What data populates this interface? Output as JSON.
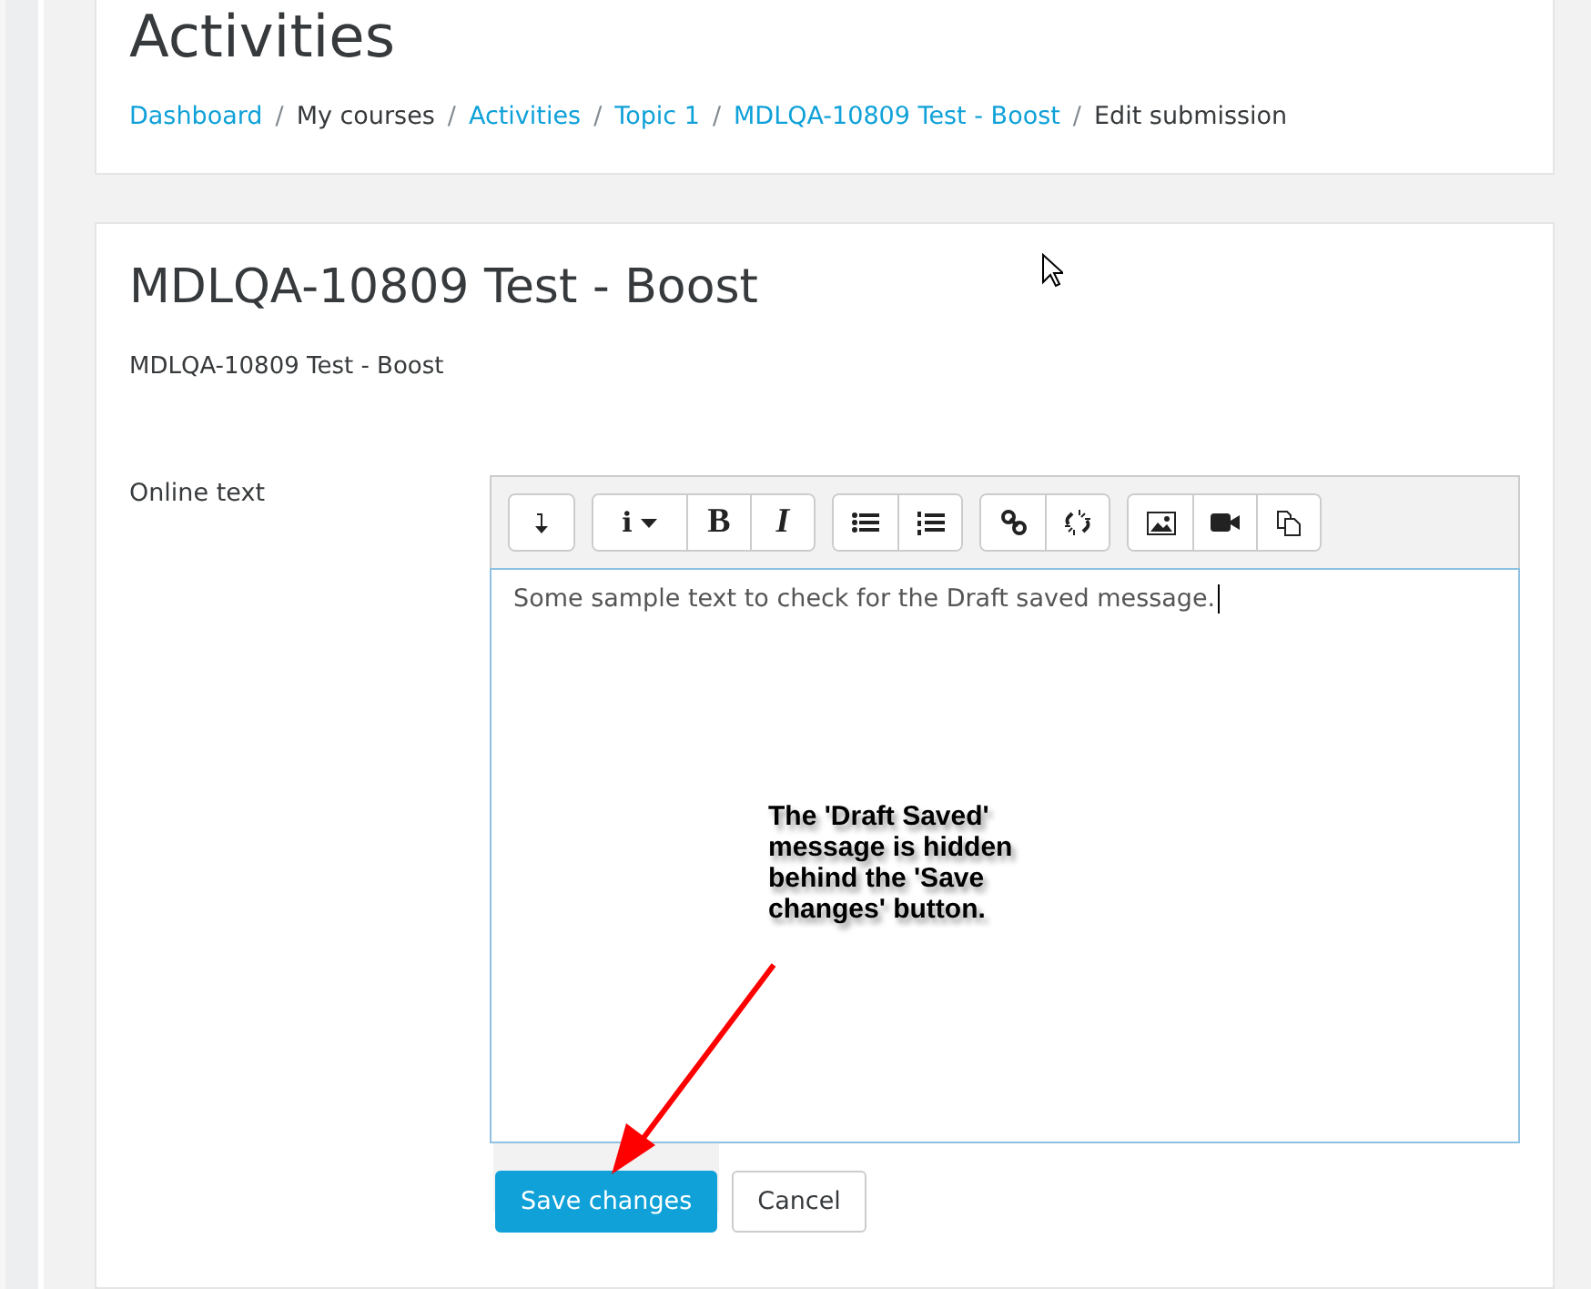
{
  "page_header": {
    "title": "Activities",
    "breadcrumb": [
      {
        "label": "Dashboard",
        "link": true
      },
      {
        "label": "My courses",
        "link": false,
        "separator": "/"
      },
      {
        "label": "Activities",
        "link": true,
        "separator": "/"
      },
      {
        "label": "Topic 1",
        "link": true,
        "separator": "/"
      },
      {
        "label": "MDLQA-10809 Test - Boost",
        "link": true,
        "separator": "/"
      },
      {
        "label": "Edit submission",
        "link": false,
        "separator": "/"
      }
    ]
  },
  "assignment": {
    "title": "MDLQA-10809 Test - Boost",
    "description": "MDLQA-10809 Test - Boost"
  },
  "form": {
    "field_label": "Online text",
    "toolbar_groups": [
      [
        {
          "kind": "collapse"
        }
      ],
      [
        {
          "kind": "style",
          "label": "i"
        },
        {
          "kind": "bold",
          "label": "B"
        },
        {
          "kind": "italic",
          "label": "I"
        }
      ],
      [
        {
          "kind": "bullets"
        },
        {
          "kind": "numbers"
        }
      ],
      [
        {
          "kind": "link"
        },
        {
          "kind": "unlink"
        }
      ],
      [
        {
          "kind": "image"
        },
        {
          "kind": "video"
        },
        {
          "kind": "media"
        }
      ]
    ],
    "value": "Some sample text to check for the Draft saved message.",
    "buttons": [
      {
        "label": "Save changes",
        "kind": "primary"
      },
      {
        "label": "Cancel",
        "kind": "secondary"
      }
    ]
  },
  "annotation": {
    "text": "The 'Draft Saved' message is hidden behind the 'Save changes' button."
  }
}
